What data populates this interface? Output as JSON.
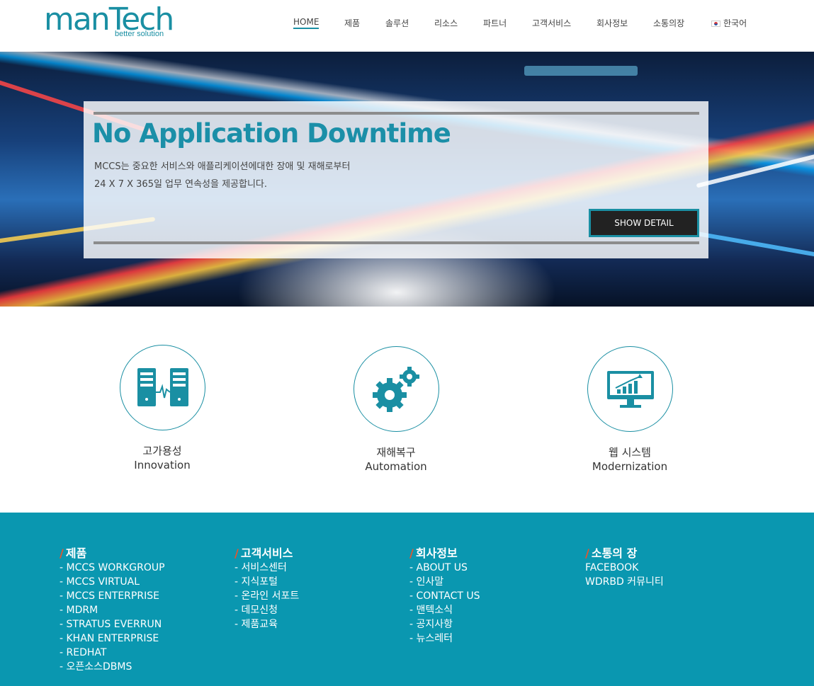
{
  "header": {
    "logo_main": "manTech",
    "logo_sub": "better solution",
    "nav": [
      {
        "label": "HOME"
      },
      {
        "label": "제품"
      },
      {
        "label": "솔루션"
      },
      {
        "label": "리소스"
      },
      {
        "label": "파트너"
      },
      {
        "label": "고객서비스"
      },
      {
        "label": "회사정보"
      },
      {
        "label": "소통의장"
      },
      {
        "label": "한국어"
      }
    ]
  },
  "hero": {
    "headline": "No Application Downtime",
    "desc_line1": "MCCS는 중요한 서비스와 애플리케이션에대한 장애 및 재해로부터",
    "desc_line2": "24 X 7 X 365일 업무 연속성을 제공합니다.",
    "button_label": "SHOW DETAIL"
  },
  "features": [
    {
      "icon": "servers-icon",
      "ko": "고가용성",
      "en": "Innovation"
    },
    {
      "icon": "gears-icon",
      "ko": "재해복구",
      "en": "Automation"
    },
    {
      "icon": "monitor-chart-icon",
      "ko": "웹 시스템",
      "en": "Modernization"
    }
  ],
  "footer": {
    "columns": [
      {
        "title": "제품",
        "links": [
          "- MCCS WORKGROUP",
          "- MCCS VIRTUAL",
          "- MCCS ENTERPRISE",
          "- MDRM",
          "- STRATUS EVERRUN",
          "- KHAN ENTERPRISE",
          "- REDHAT",
          "- 오픈소스DBMS"
        ]
      },
      {
        "title": "고객서비스",
        "links": [
          "- 서비스센터",
          "- 지식포털",
          "- 온라인 서포트",
          "- 데모신청",
          "- 제품교육"
        ]
      },
      {
        "title": "회사정보",
        "links": [
          "- ABOUT US",
          "- 인사말",
          "- CONTACT US",
          "- 맨텍소식",
          "- 공지사항",
          "- 뉴스레터"
        ]
      },
      {
        "title": "소통의 장",
        "links": [
          "FACEBOOK",
          "WDRBD 커뮤니티"
        ]
      }
    ]
  },
  "colors": {
    "accent": "#1a8fa3",
    "footer_bg": "#0a97b0",
    "title_slash": "#e8542b"
  }
}
